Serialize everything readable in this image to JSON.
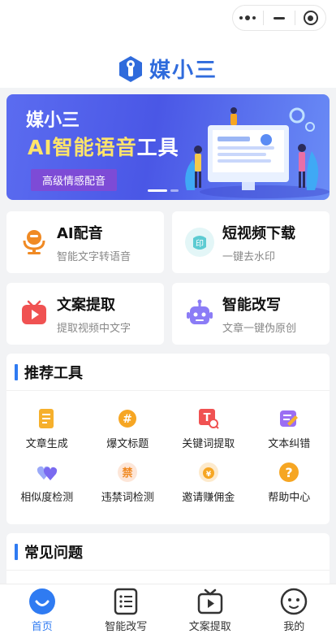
{
  "brand": {
    "name": "媒小三"
  },
  "banner": {
    "line1": "媒小三",
    "line2_highlight": "AI智能语音",
    "line2_rest": "工具",
    "tag": "高级情感配音"
  },
  "feature_cards": [
    {
      "title": "AI配音",
      "subtitle": "智能文字转语音",
      "icon": "microphone-icon"
    },
    {
      "title": "短视频下载",
      "subtitle": "一键去水印",
      "icon": "stamp-icon"
    },
    {
      "title": "文案提取",
      "subtitle": "提取视频中文字",
      "icon": "play-icon"
    },
    {
      "title": "智能改写",
      "subtitle": "文章一键伪原创",
      "icon": "robot-icon"
    }
  ],
  "recommend": {
    "title": "推荐工具",
    "tools": [
      {
        "label": "文章生成",
        "icon": "document-icon"
      },
      {
        "label": "爆文标题",
        "icon": "hashtag-icon"
      },
      {
        "label": "关键词提取",
        "icon": "keyword-icon"
      },
      {
        "label": "文本纠错",
        "icon": "edit-icon"
      },
      {
        "label": "相似度检测",
        "icon": "hearts-icon"
      },
      {
        "label": "违禁词检测",
        "icon": "forbidden-icon"
      },
      {
        "label": "邀请赚佣金",
        "icon": "coin-icon"
      },
      {
        "label": "帮助中心",
        "icon": "question-icon"
      }
    ]
  },
  "faq": {
    "title": "常见问题"
  },
  "tabbar": {
    "items": [
      {
        "label": "首页",
        "active": true
      },
      {
        "label": "智能改写",
        "active": false
      },
      {
        "label": "文案提取",
        "active": false
      },
      {
        "label": "我的",
        "active": false
      }
    ]
  },
  "colors": {
    "accent": "#2f7bf2",
    "brand": "#2f6bdc",
    "banner_highlight": "#ffe46a"
  }
}
